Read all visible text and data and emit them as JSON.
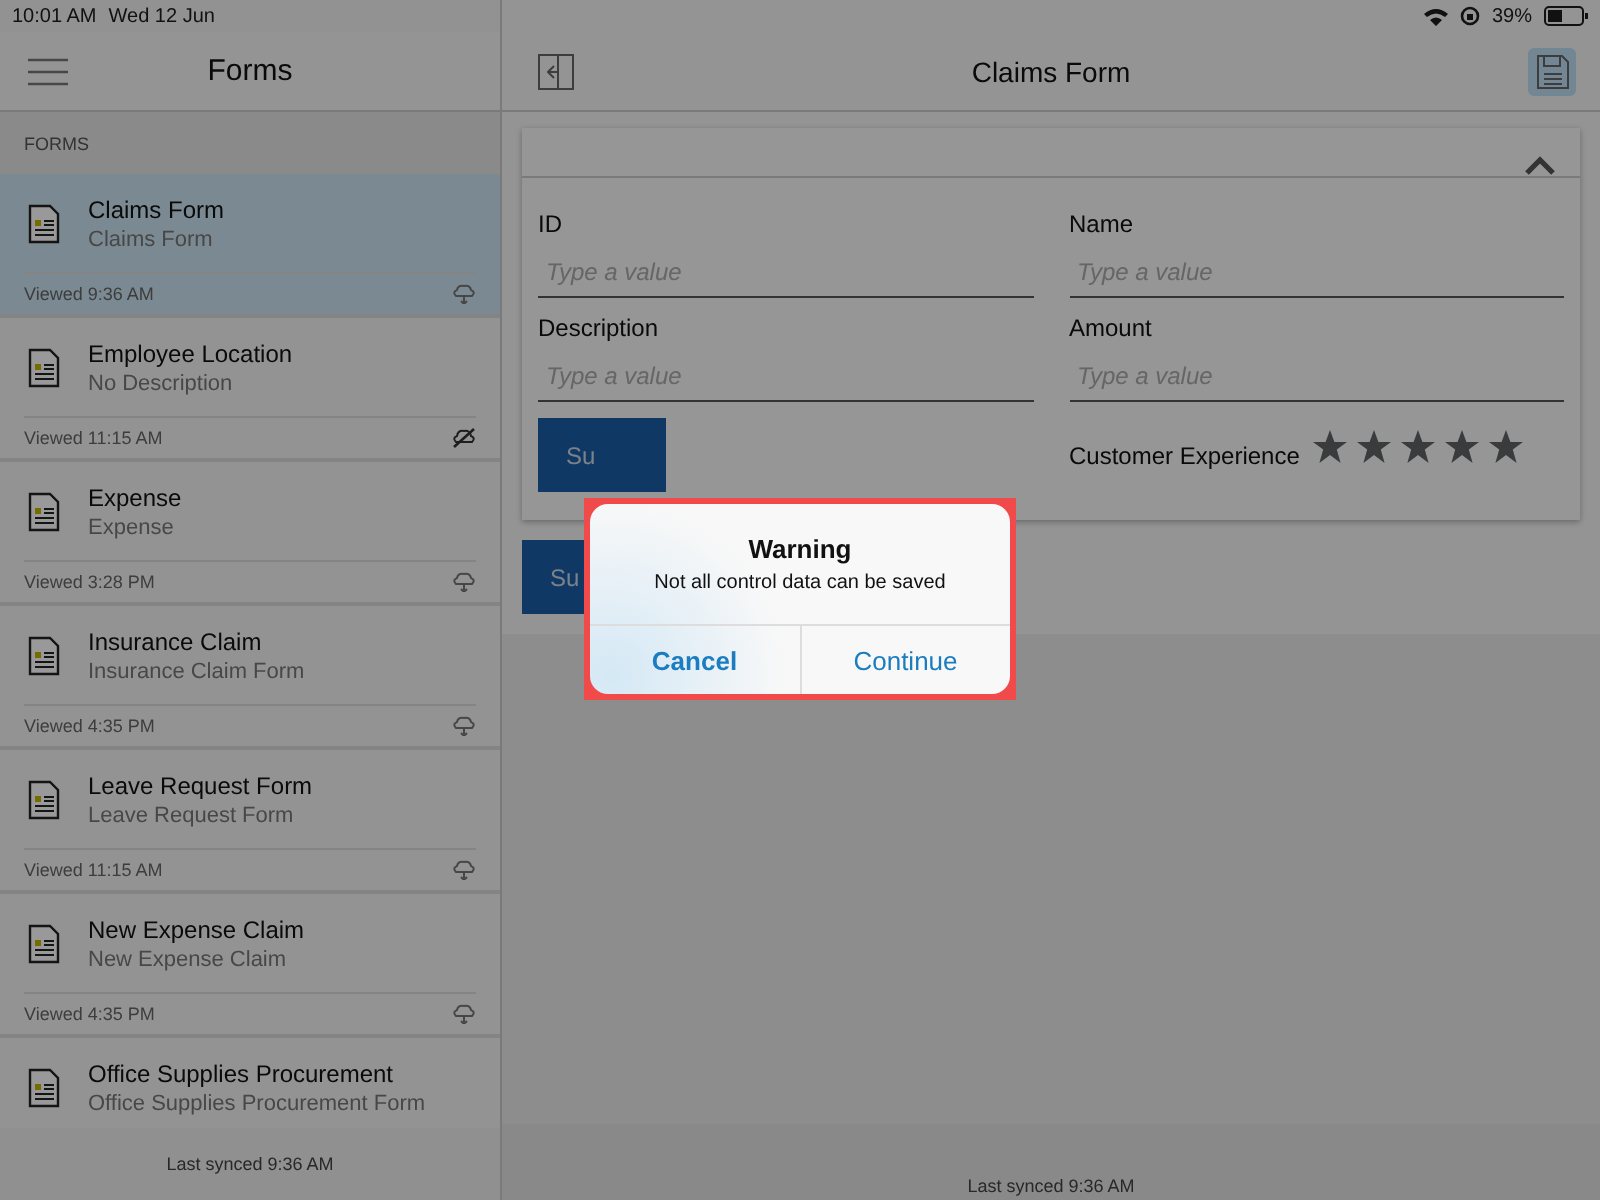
{
  "status_bar": {
    "time": "10:01 AM",
    "date": "Wed 12 Jun",
    "battery": "39%"
  },
  "sidebar": {
    "title": "Forms",
    "section": "FORMS",
    "items": [
      {
        "title": "Claims Form",
        "subtitle": "Claims Form",
        "viewed": "Viewed 9:36 AM",
        "selected": true,
        "cloud_slashed": false
      },
      {
        "title": "Employee Location",
        "subtitle": "No Description",
        "viewed": "Viewed 11:15 AM",
        "selected": false,
        "cloud_slashed": true
      },
      {
        "title": "Expense",
        "subtitle": "Expense",
        "viewed": "Viewed 3:28 PM",
        "selected": false,
        "cloud_slashed": false
      },
      {
        "title": "Insurance Claim",
        "subtitle": "Insurance Claim Form",
        "viewed": "Viewed 4:35 PM",
        "selected": false,
        "cloud_slashed": false
      },
      {
        "title": "Leave Request Form",
        "subtitle": "Leave Request Form",
        "viewed": "Viewed 11:15 AM",
        "selected": false,
        "cloud_slashed": false
      },
      {
        "title": "New Expense Claim",
        "subtitle": "New Expense Claim",
        "viewed": "Viewed 4:35 PM",
        "selected": false,
        "cloud_slashed": false
      },
      {
        "title": "Office Supplies Procurement",
        "subtitle": "Office Supplies Procurement Form",
        "selected": false
      }
    ],
    "footer": "Last synced 9:36 AM"
  },
  "main": {
    "title": "Claims Form",
    "fields": [
      {
        "label": "ID",
        "placeholder": "Type a value"
      },
      {
        "label": "Name",
        "placeholder": "Type a value"
      },
      {
        "label": "Description",
        "placeholder": "Type a value"
      },
      {
        "label": "Amount",
        "placeholder": "Type a value"
      }
    ],
    "inner_button": "Su",
    "rating": {
      "label": "Customer Experience",
      "stars": 5
    },
    "submit_button": "Su",
    "footer": "Last synced 9:36 AM"
  },
  "dialog": {
    "title": "Warning",
    "message": "Not all control data can be saved",
    "highlighted": true,
    "buttons": [
      {
        "label": "Cancel",
        "default": true
      },
      {
        "label": "Continue",
        "default": false
      }
    ]
  }
}
